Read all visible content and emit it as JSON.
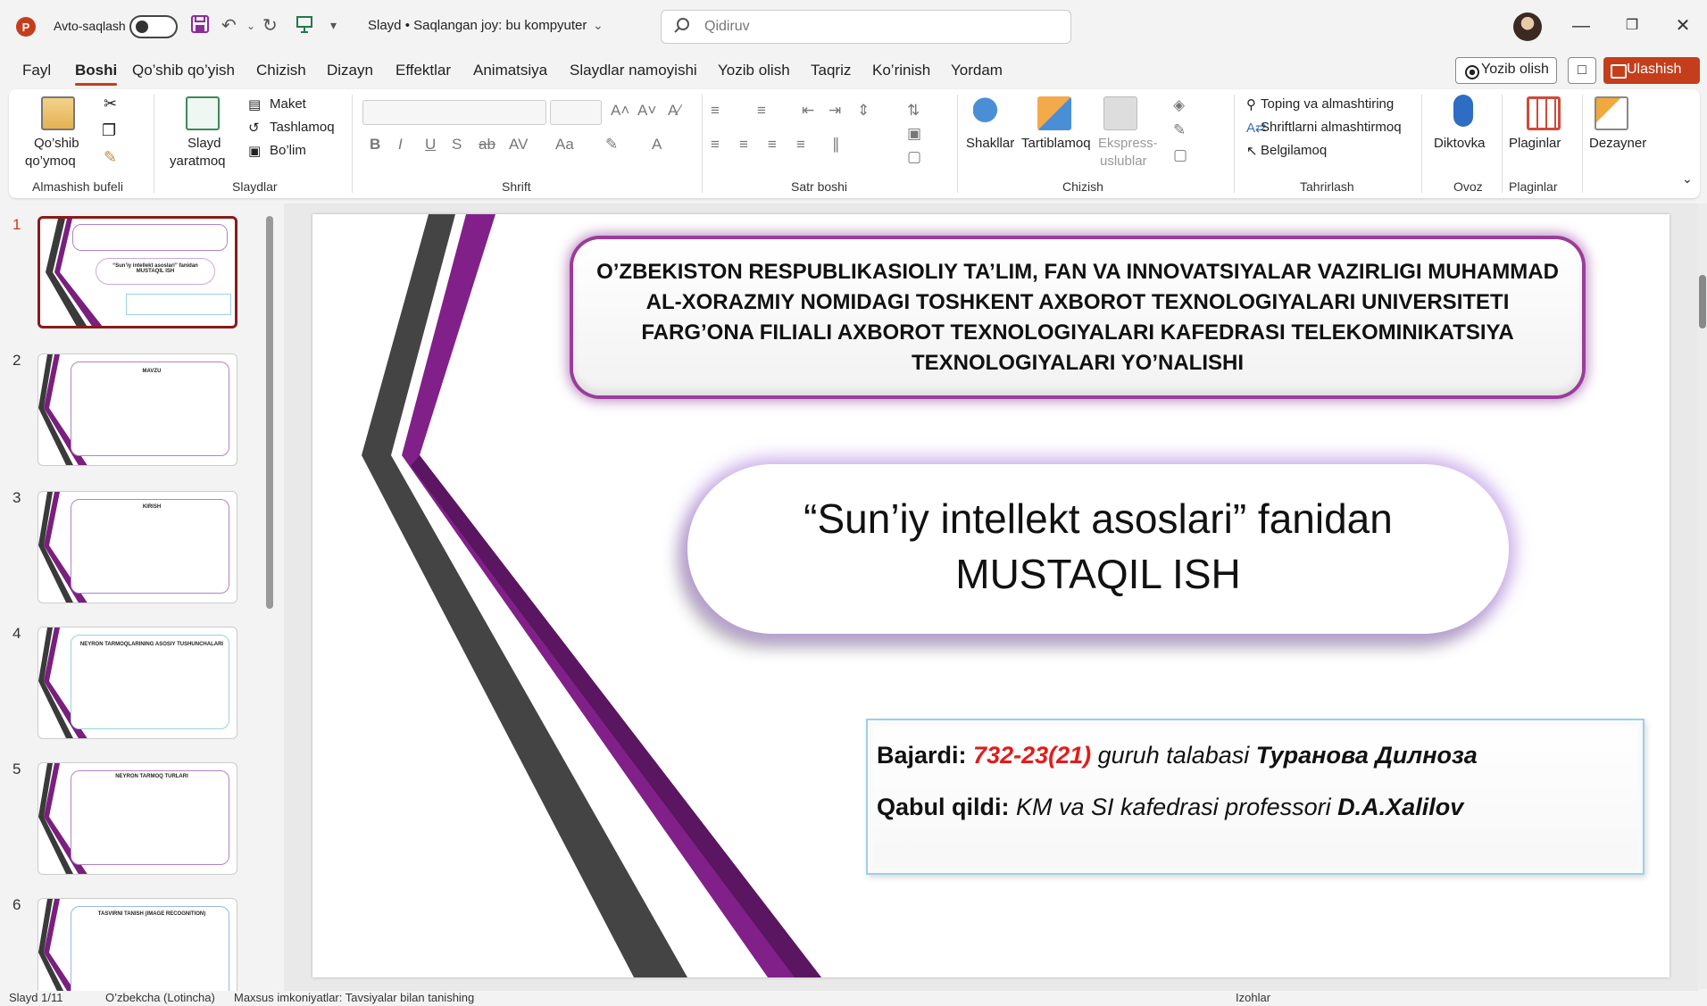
{
  "titlebar": {
    "autosave_label": "Avto-saqlash",
    "doc_title": "Slayd  •  Saqlangan joy: bu kompyuter",
    "search_placeholder": "Qidiruv"
  },
  "menu": {
    "tabs": [
      "Fayl",
      "Boshi",
      "Qo’shib qo’yish",
      "Chizish",
      "Dizayn",
      "Effektlar",
      "Animatsiya",
      "Slaydlar namoyishi",
      "Yozib olish",
      "Taqriz",
      "Ko’rinish",
      "Yordam"
    ],
    "record_label": "Yozib olish",
    "share_label": "Ulashish"
  },
  "ribbon": {
    "clipboard": {
      "paste_line1": "Qo’shib",
      "paste_line2": "qo’ymoq",
      "label": "Almashish bufeli"
    },
    "slides": {
      "new_line1": "Slayd",
      "new_line2": "yaratmoq",
      "layout": "Maket",
      "reset": "Tashlamoq",
      "section": "Bo’lim",
      "label": "Slaydlar"
    },
    "font": {
      "label": "Shrift"
    },
    "paragraph": {
      "label": "Satr boshi"
    },
    "drawing": {
      "shapes": "Shakllar",
      "arrange": "Tartiblamoq",
      "styles_line1": "Ekspress-",
      "styles_line2": "uslublar",
      "label": "Chizish"
    },
    "editing": {
      "find": "Toping va almashtiring",
      "replace_fonts": "Shriftlarni almashtirmoq",
      "select": "Belgilamoq",
      "label": "Tahrirlash"
    },
    "voice": {
      "dictate": "Diktovka",
      "label": "Ovoz"
    },
    "addins": {
      "addins": "Plaginlar",
      "label": "Plaginlar"
    },
    "designer": {
      "label": "Dezayner"
    }
  },
  "thumbnails": [
    {
      "num": "1",
      "title": "“Sun’iy intellekt asoslari” fanidan MUSTAQIL ISH"
    },
    {
      "num": "2",
      "title": "MAVZU"
    },
    {
      "num": "3",
      "title": "KIRISH"
    },
    {
      "num": "4",
      "title": "NEYRON TARMOQLARINING ASOSIY TUSHUNCHALARI"
    },
    {
      "num": "5",
      "title": "NEYRON TARMOQ TURLARI"
    },
    {
      "num": "6",
      "title": "TASVIRNI TANISH (IMAGE RECOGNITION)"
    }
  ],
  "slide": {
    "header": "O’ZBEKISTON RESPUBLIKASIOLIY TA’LIM, FAN VA INNOVATSIYALAR VAZIRLIGI MUHAMMAD AL-XORAZMIY NOMIDAGI TOSHKENT AXBOROT TEXNOLOGIYALARI UNIVERSITETI FARG’ONA FILIALI AXBOROT TEXNOLOGIYALARI KAFEDRASI TELEKOMINIKATSIYA TEXNOLOGIYALARI YO’NALISHI",
    "title_line1": "“Sun’iy intellekt asoslari” fanidan",
    "title_line2": "MUSTAQIL ISH",
    "done_label": "Bajardi:",
    "group": "732-23(21)",
    "group_suffix": "guruh talabasi",
    "student": "Туранова Дилноза",
    "accepted_label": "Qabul qildi:",
    "accepted_role": "KM va SI kafedrasi professori",
    "professor": "D.A.Xalilov"
  },
  "status": {
    "slide_count": "Slayd 1/11",
    "language": "O’zbekcha (Lotincha)",
    "accessibility": "Maxsus imkoniyatlar: Tavsiyalar bilan tanishing",
    "notes": "Izohlar"
  },
  "colors": {
    "accent": "#c43e1c",
    "purple": "#7a1f7e",
    "dark_ribbon": "#3a3a3a",
    "red_text": "#e31b1b"
  }
}
